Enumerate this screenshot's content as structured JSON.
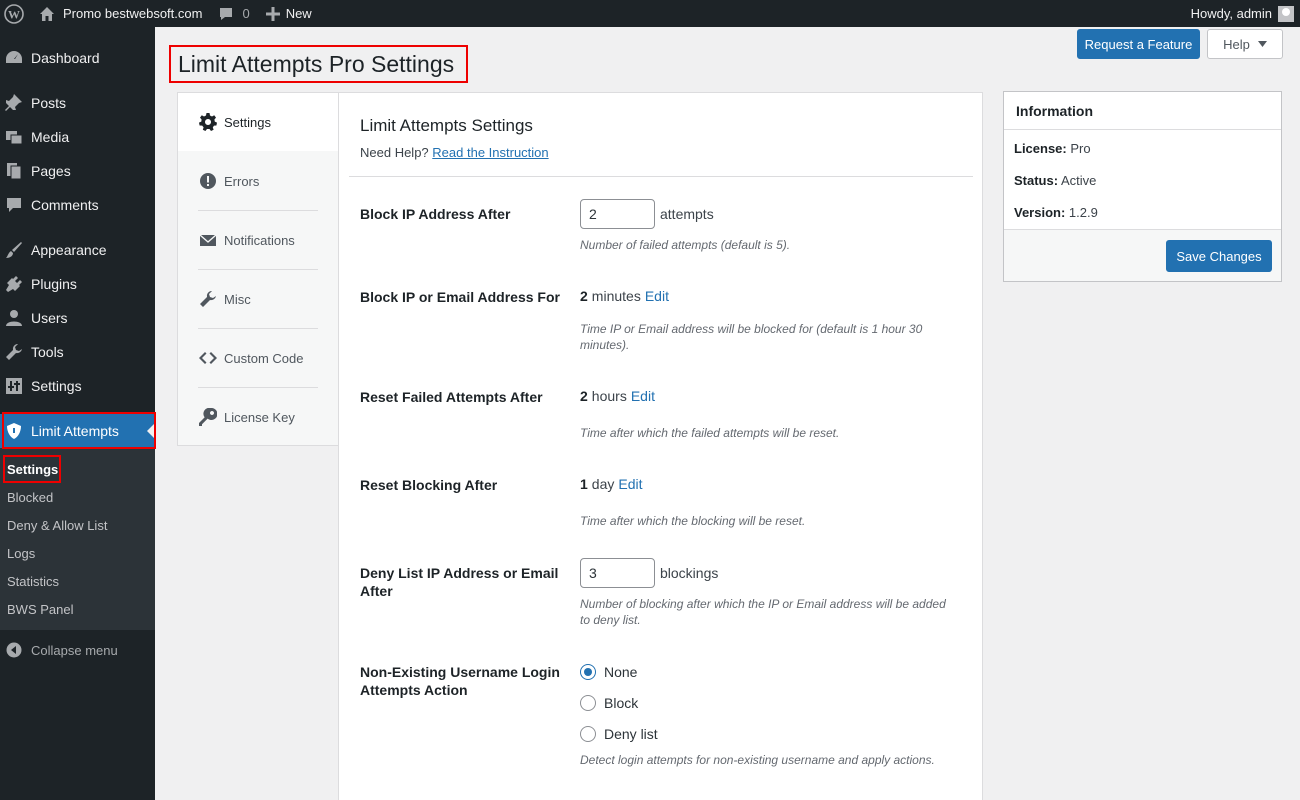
{
  "adminbar": {
    "site_name": "Promo bestwebsoft.com",
    "comments_count": "0",
    "new_label": "New",
    "howdy": "Howdy, admin"
  },
  "sidebar": {
    "items": [
      {
        "label": "Dashboard",
        "icon": "dashboard-icon"
      },
      {
        "label": "Posts",
        "icon": "pin-icon"
      },
      {
        "label": "Media",
        "icon": "media-icon"
      },
      {
        "label": "Pages",
        "icon": "pages-icon"
      },
      {
        "label": "Comments",
        "icon": "comment-icon"
      },
      {
        "label": "Appearance",
        "icon": "brush-icon"
      },
      {
        "label": "Plugins",
        "icon": "plug-icon"
      },
      {
        "label": "Users",
        "icon": "user-icon"
      },
      {
        "label": "Tools",
        "icon": "wrench-icon"
      },
      {
        "label": "Settings",
        "icon": "sliders-icon"
      },
      {
        "label": "Limit Attempts",
        "icon": "shield-icon"
      }
    ],
    "submenu": [
      "Settings",
      "Blocked",
      "Deny & Allow List",
      "Logs",
      "Statistics",
      "BWS Panel"
    ],
    "collapse_label": "Collapse menu"
  },
  "page": {
    "title": "Limit Attempts Pro Settings",
    "request_feature": "Request a Feature",
    "help": "Help"
  },
  "tabs": [
    "Settings",
    "Errors",
    "Notifications",
    "Misc",
    "Custom Code",
    "License Key"
  ],
  "main": {
    "section_title": "Limit Attempts Settings",
    "need_help": "Need Help?",
    "instruction_link": "Read the Instruction",
    "block_ip_after": {
      "label": "Block IP Address After",
      "value": "2",
      "unit": "attempts",
      "desc": "Number of failed attempts (default is 5)."
    },
    "block_for": {
      "label": "Block IP or Email Address For",
      "value": "2",
      "unit": "minutes",
      "edit": "Edit",
      "desc": "Time IP or Email address will be blocked for (default is 1 hour 30 minutes)."
    },
    "reset_failed": {
      "label": "Reset Failed Attempts After",
      "value": "2",
      "unit": "hours",
      "edit": "Edit",
      "desc": "Time after which the failed attempts will be reset."
    },
    "reset_blocking": {
      "label": "Reset Blocking After",
      "value": "1",
      "unit": "day",
      "edit": "Edit",
      "desc": "Time after which the blocking will be reset."
    },
    "deny_list": {
      "label": "Deny List IP Address or Email After",
      "value": "3",
      "unit": "blockings",
      "desc": "Number of blocking after which the IP or Email address will be added to deny list."
    },
    "non_existing": {
      "label": "Non-Existing Username Login Attempts Action",
      "options": [
        "None",
        "Block",
        "Deny list"
      ],
      "selected": "None",
      "desc": "Detect login attempts for non-existing username and apply actions."
    }
  },
  "info": {
    "title": "Information",
    "license_label": "License:",
    "license_value": "Pro",
    "status_label": "Status:",
    "status_value": "Active",
    "version_label": "Version:",
    "version_value": "1.2.9",
    "save_button": "Save Changes"
  },
  "colors": {
    "accent": "#2271b1",
    "sidebar_bg": "#1d2327",
    "highlight": "#e00000"
  }
}
